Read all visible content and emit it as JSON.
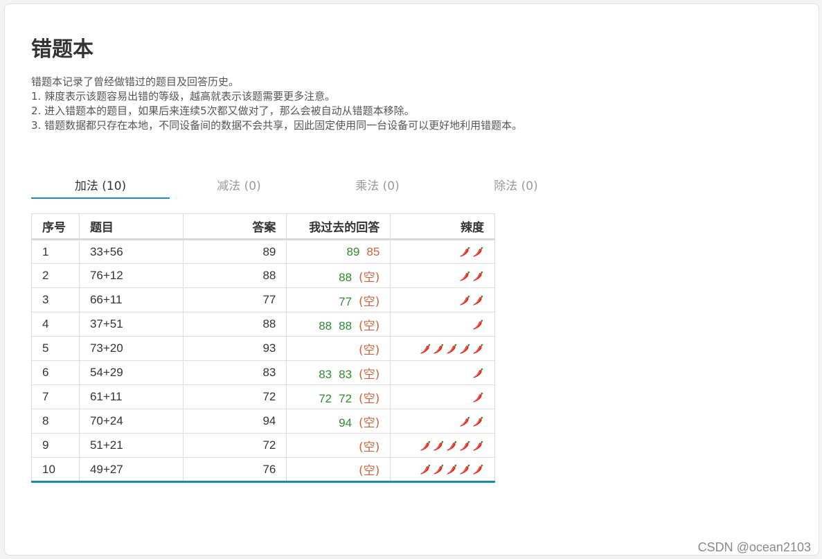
{
  "page": {
    "title": "错题本",
    "description": [
      "错题本记录了曾经做错过的题目及回答历史。",
      "1. 辣度表示该题容易出错的等级，越高就表示该题需要更多注意。",
      "2. 进入错题本的题目，如果后来连续5次都又做对了，那么会被自动从错题本移除。",
      "3. 错题数据都只存在本地，不同设备间的数据不会共享，因此固定使用同一台设备可以更好地利用错题本。"
    ]
  },
  "tabs": [
    {
      "label": "加法 (10)",
      "active": true
    },
    {
      "label": "减法 (0)",
      "active": false
    },
    {
      "label": "乘法 (0)",
      "active": false
    },
    {
      "label": "除法 (0)",
      "active": false
    }
  ],
  "table": {
    "headers": [
      "序号",
      "题目",
      "答案",
      "我过去的回答",
      "辣度"
    ],
    "rows": [
      {
        "index": "1",
        "question": "33+56",
        "answer": "89",
        "past": [
          {
            "v": "89",
            "s": "correct"
          },
          {
            "v": "85",
            "s": "wrong"
          }
        ],
        "spice": 2
      },
      {
        "index": "2",
        "question": "76+12",
        "answer": "88",
        "past": [
          {
            "v": "88",
            "s": "correct"
          },
          {
            "v": "(空)",
            "s": "empty"
          }
        ],
        "spice": 2
      },
      {
        "index": "3",
        "question": "66+11",
        "answer": "77",
        "past": [
          {
            "v": "77",
            "s": "correct"
          },
          {
            "v": "(空)",
            "s": "empty"
          }
        ],
        "spice": 2
      },
      {
        "index": "4",
        "question": "37+51",
        "answer": "88",
        "past": [
          {
            "v": "88",
            "s": "correct"
          },
          {
            "v": "88",
            "s": "correct"
          },
          {
            "v": "(空)",
            "s": "empty"
          }
        ],
        "spice": 1
      },
      {
        "index": "5",
        "question": "73+20",
        "answer": "93",
        "past": [
          {
            "v": "(空)",
            "s": "empty"
          }
        ],
        "spice": 5
      },
      {
        "index": "6",
        "question": "54+29",
        "answer": "83",
        "past": [
          {
            "v": "83",
            "s": "correct"
          },
          {
            "v": "83",
            "s": "correct"
          },
          {
            "v": "(空)",
            "s": "empty"
          }
        ],
        "spice": 1
      },
      {
        "index": "7",
        "question": "61+11",
        "answer": "72",
        "past": [
          {
            "v": "72",
            "s": "correct"
          },
          {
            "v": "72",
            "s": "correct"
          },
          {
            "v": "(空)",
            "s": "empty"
          }
        ],
        "spice": 1
      },
      {
        "index": "8",
        "question": "70+24",
        "answer": "94",
        "past": [
          {
            "v": "94",
            "s": "correct"
          },
          {
            "v": "(空)",
            "s": "empty"
          }
        ],
        "spice": 2
      },
      {
        "index": "9",
        "question": "51+21",
        "answer": "72",
        "past": [
          {
            "v": "(空)",
            "s": "empty"
          }
        ],
        "spice": 5
      },
      {
        "index": "10",
        "question": "49+27",
        "answer": "76",
        "past": [
          {
            "v": "(空)",
            "s": "empty"
          }
        ],
        "spice": 5
      }
    ]
  },
  "colors": {
    "correct": "#2e8b2e",
    "wrong": "#c8643c",
    "accent": "#1e88c8",
    "table_bottom": "#1a88a8"
  },
  "icons": {
    "spice": "chili-pepper-icon"
  },
  "watermark": "CSDN @ocean2103"
}
